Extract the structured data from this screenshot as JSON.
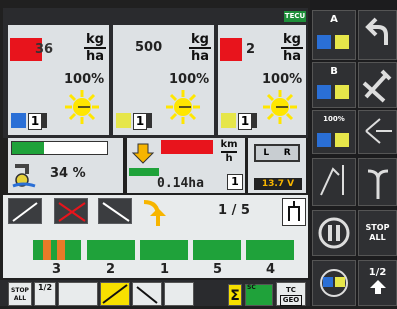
{
  "header": {
    "tecu": "TECU"
  },
  "products": [
    {
      "value_suffix": "36",
      "unit_top": "kg",
      "unit_bottom": "ha",
      "percent": "100%",
      "label_num": "1"
    },
    {
      "value": "500",
      "unit_top": "kg",
      "unit_bottom": "ha",
      "percent": "100%",
      "label_num": "1"
    },
    {
      "value_suffix": "2",
      "unit_top": "kg",
      "unit_bottom": "ha",
      "percent": "100%",
      "label_num": "1"
    }
  ],
  "fill": {
    "percent_text": "34 %",
    "level": 0.34
  },
  "field": {
    "speed_unit_top": "km",
    "speed_unit_bottom": "h",
    "area": "0.14ha",
    "box_num": "1",
    "voltage": "13.7 V",
    "lr": [
      "L",
      "R"
    ]
  },
  "section": {
    "counter": "1 / 5"
  },
  "sections": [
    "3",
    "2",
    "1",
    "5",
    "4"
  ],
  "side": {
    "a_label": "A",
    "b_label": "B",
    "pct_label": "100%",
    "stop_all": [
      "STOP",
      "ALL"
    ],
    "half_label": "1/2"
  },
  "bottom": {
    "stop_all": [
      "STOP",
      "ALL"
    ],
    "half": "1/2",
    "tc_label": "TC",
    "geo_label": "GEO",
    "sc_label": "SC"
  }
}
